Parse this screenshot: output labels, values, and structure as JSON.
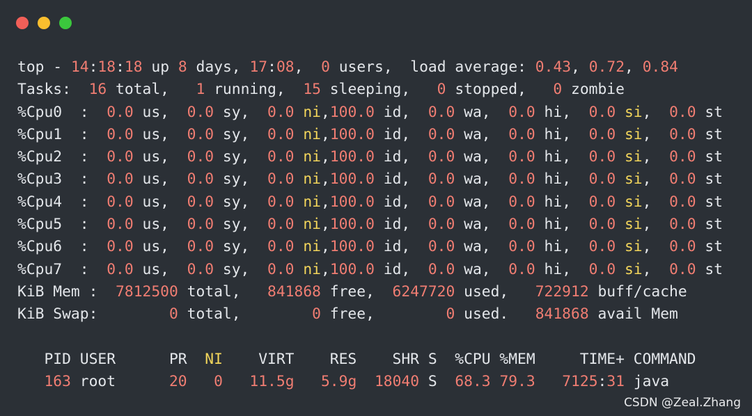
{
  "window": {
    "controls": {
      "close_color": "#f25f58",
      "minimize_color": "#f9be2e",
      "maximize_color": "#3bc73d"
    }
  },
  "colors": {
    "background": "#2b3036",
    "text": "#e3e6ea",
    "value": "#f07d72",
    "highlight": "#f2d55b"
  },
  "terminal": {
    "lines": [
      [
        {
          "t": "top - ",
          "c": "w"
        },
        {
          "t": "14",
          "c": "v"
        },
        {
          "t": ":",
          "c": "w"
        },
        {
          "t": "18",
          "c": "v"
        },
        {
          "t": ":",
          "c": "w"
        },
        {
          "t": "18",
          "c": "v"
        },
        {
          "t": " up ",
          "c": "w"
        },
        {
          "t": "8",
          "c": "v"
        },
        {
          "t": " days, ",
          "c": "w"
        },
        {
          "t": "17",
          "c": "v"
        },
        {
          "t": ":",
          "c": "w"
        },
        {
          "t": "08",
          "c": "v"
        },
        {
          "t": ",  ",
          "c": "w"
        },
        {
          "t": "0",
          "c": "v"
        },
        {
          "t": " users,  load average: ",
          "c": "w"
        },
        {
          "t": "0.43",
          "c": "v"
        },
        {
          "t": ", ",
          "c": "w"
        },
        {
          "t": "0.72",
          "c": "v"
        },
        {
          "t": ", ",
          "c": "w"
        },
        {
          "t": "0.84",
          "c": "v"
        }
      ],
      [
        {
          "t": "Tasks:  ",
          "c": "w"
        },
        {
          "t": "16",
          "c": "v"
        },
        {
          "t": " total,   ",
          "c": "w"
        },
        {
          "t": "1",
          "c": "v"
        },
        {
          "t": " running,  ",
          "c": "w"
        },
        {
          "t": "15",
          "c": "v"
        },
        {
          "t": " sleeping,   ",
          "c": "w"
        },
        {
          "t": "0",
          "c": "v"
        },
        {
          "t": " stopped,   ",
          "c": "w"
        },
        {
          "t": "0",
          "c": "v"
        },
        {
          "t": " zombie",
          "c": "w"
        }
      ],
      [
        {
          "t": "%Cpu0  :  ",
          "c": "w"
        },
        {
          "t": "0.0",
          "c": "v"
        },
        {
          "t": " us,  ",
          "c": "w"
        },
        {
          "t": "0.0",
          "c": "v"
        },
        {
          "t": " sy,  ",
          "c": "w"
        },
        {
          "t": "0.0",
          "c": "v"
        },
        {
          "t": " ",
          "c": "w"
        },
        {
          "t": "ni",
          "c": "y"
        },
        {
          "t": ",",
          "c": "w"
        },
        {
          "t": "100.0",
          "c": "v"
        },
        {
          "t": " id,  ",
          "c": "w"
        },
        {
          "t": "0.0",
          "c": "v"
        },
        {
          "t": " wa,  ",
          "c": "w"
        },
        {
          "t": "0.0",
          "c": "v"
        },
        {
          "t": " hi,  ",
          "c": "w"
        },
        {
          "t": "0.0",
          "c": "v"
        },
        {
          "t": " ",
          "c": "w"
        },
        {
          "t": "si",
          "c": "y"
        },
        {
          "t": ",  ",
          "c": "w"
        },
        {
          "t": "0.0",
          "c": "v"
        },
        {
          "t": " st",
          "c": "w"
        }
      ],
      [
        {
          "t": "%Cpu1  :  ",
          "c": "w"
        },
        {
          "t": "0.0",
          "c": "v"
        },
        {
          "t": " us,  ",
          "c": "w"
        },
        {
          "t": "0.0",
          "c": "v"
        },
        {
          "t": " sy,  ",
          "c": "w"
        },
        {
          "t": "0.0",
          "c": "v"
        },
        {
          "t": " ",
          "c": "w"
        },
        {
          "t": "ni",
          "c": "y"
        },
        {
          "t": ",",
          "c": "w"
        },
        {
          "t": "100.0",
          "c": "v"
        },
        {
          "t": " id,  ",
          "c": "w"
        },
        {
          "t": "0.0",
          "c": "v"
        },
        {
          "t": " wa,  ",
          "c": "w"
        },
        {
          "t": "0.0",
          "c": "v"
        },
        {
          "t": " hi,  ",
          "c": "w"
        },
        {
          "t": "0.0",
          "c": "v"
        },
        {
          "t": " ",
          "c": "w"
        },
        {
          "t": "si",
          "c": "y"
        },
        {
          "t": ",  ",
          "c": "w"
        },
        {
          "t": "0.0",
          "c": "v"
        },
        {
          "t": " st",
          "c": "w"
        }
      ],
      [
        {
          "t": "%Cpu2  :  ",
          "c": "w"
        },
        {
          "t": "0.0",
          "c": "v"
        },
        {
          "t": " us,  ",
          "c": "w"
        },
        {
          "t": "0.0",
          "c": "v"
        },
        {
          "t": " sy,  ",
          "c": "w"
        },
        {
          "t": "0.0",
          "c": "v"
        },
        {
          "t": " ",
          "c": "w"
        },
        {
          "t": "ni",
          "c": "y"
        },
        {
          "t": ",",
          "c": "w"
        },
        {
          "t": "100.0",
          "c": "v"
        },
        {
          "t": " id,  ",
          "c": "w"
        },
        {
          "t": "0.0",
          "c": "v"
        },
        {
          "t": " wa,  ",
          "c": "w"
        },
        {
          "t": "0.0",
          "c": "v"
        },
        {
          "t": " hi,  ",
          "c": "w"
        },
        {
          "t": "0.0",
          "c": "v"
        },
        {
          "t": " ",
          "c": "w"
        },
        {
          "t": "si",
          "c": "y"
        },
        {
          "t": ",  ",
          "c": "w"
        },
        {
          "t": "0.0",
          "c": "v"
        },
        {
          "t": " st",
          "c": "w"
        }
      ],
      [
        {
          "t": "%Cpu3  :  ",
          "c": "w"
        },
        {
          "t": "0.0",
          "c": "v"
        },
        {
          "t": " us,  ",
          "c": "w"
        },
        {
          "t": "0.0",
          "c": "v"
        },
        {
          "t": " sy,  ",
          "c": "w"
        },
        {
          "t": "0.0",
          "c": "v"
        },
        {
          "t": " ",
          "c": "w"
        },
        {
          "t": "ni",
          "c": "y"
        },
        {
          "t": ",",
          "c": "w"
        },
        {
          "t": "100.0",
          "c": "v"
        },
        {
          "t": " id,  ",
          "c": "w"
        },
        {
          "t": "0.0",
          "c": "v"
        },
        {
          "t": " wa,  ",
          "c": "w"
        },
        {
          "t": "0.0",
          "c": "v"
        },
        {
          "t": " hi,  ",
          "c": "w"
        },
        {
          "t": "0.0",
          "c": "v"
        },
        {
          "t": " ",
          "c": "w"
        },
        {
          "t": "si",
          "c": "y"
        },
        {
          "t": ",  ",
          "c": "w"
        },
        {
          "t": "0.0",
          "c": "v"
        },
        {
          "t": " st",
          "c": "w"
        }
      ],
      [
        {
          "t": "%Cpu4  :  ",
          "c": "w"
        },
        {
          "t": "0.0",
          "c": "v"
        },
        {
          "t": " us,  ",
          "c": "w"
        },
        {
          "t": "0.0",
          "c": "v"
        },
        {
          "t": " sy,  ",
          "c": "w"
        },
        {
          "t": "0.0",
          "c": "v"
        },
        {
          "t": " ",
          "c": "w"
        },
        {
          "t": "ni",
          "c": "y"
        },
        {
          "t": ",",
          "c": "w"
        },
        {
          "t": "100.0",
          "c": "v"
        },
        {
          "t": " id,  ",
          "c": "w"
        },
        {
          "t": "0.0",
          "c": "v"
        },
        {
          "t": " wa,  ",
          "c": "w"
        },
        {
          "t": "0.0",
          "c": "v"
        },
        {
          "t": " hi,  ",
          "c": "w"
        },
        {
          "t": "0.0",
          "c": "v"
        },
        {
          "t": " ",
          "c": "w"
        },
        {
          "t": "si",
          "c": "y"
        },
        {
          "t": ",  ",
          "c": "w"
        },
        {
          "t": "0.0",
          "c": "v"
        },
        {
          "t": " st",
          "c": "w"
        }
      ],
      [
        {
          "t": "%Cpu5  :  ",
          "c": "w"
        },
        {
          "t": "0.0",
          "c": "v"
        },
        {
          "t": " us,  ",
          "c": "w"
        },
        {
          "t": "0.0",
          "c": "v"
        },
        {
          "t": " sy,  ",
          "c": "w"
        },
        {
          "t": "0.0",
          "c": "v"
        },
        {
          "t": " ",
          "c": "w"
        },
        {
          "t": "ni",
          "c": "y"
        },
        {
          "t": ",",
          "c": "w"
        },
        {
          "t": "100.0",
          "c": "v"
        },
        {
          "t": " id,  ",
          "c": "w"
        },
        {
          "t": "0.0",
          "c": "v"
        },
        {
          "t": " wa,  ",
          "c": "w"
        },
        {
          "t": "0.0",
          "c": "v"
        },
        {
          "t": " hi,  ",
          "c": "w"
        },
        {
          "t": "0.0",
          "c": "v"
        },
        {
          "t": " ",
          "c": "w"
        },
        {
          "t": "si",
          "c": "y"
        },
        {
          "t": ",  ",
          "c": "w"
        },
        {
          "t": "0.0",
          "c": "v"
        },
        {
          "t": " st",
          "c": "w"
        }
      ],
      [
        {
          "t": "%Cpu6  :  ",
          "c": "w"
        },
        {
          "t": "0.0",
          "c": "v"
        },
        {
          "t": " us,  ",
          "c": "w"
        },
        {
          "t": "0.0",
          "c": "v"
        },
        {
          "t": " sy,  ",
          "c": "w"
        },
        {
          "t": "0.0",
          "c": "v"
        },
        {
          "t": " ",
          "c": "w"
        },
        {
          "t": "ni",
          "c": "y"
        },
        {
          "t": ",",
          "c": "w"
        },
        {
          "t": "100.0",
          "c": "v"
        },
        {
          "t": " id,  ",
          "c": "w"
        },
        {
          "t": "0.0",
          "c": "v"
        },
        {
          "t": " wa,  ",
          "c": "w"
        },
        {
          "t": "0.0",
          "c": "v"
        },
        {
          "t": " hi,  ",
          "c": "w"
        },
        {
          "t": "0.0",
          "c": "v"
        },
        {
          "t": " ",
          "c": "w"
        },
        {
          "t": "si",
          "c": "y"
        },
        {
          "t": ",  ",
          "c": "w"
        },
        {
          "t": "0.0",
          "c": "v"
        },
        {
          "t": " st",
          "c": "w"
        }
      ],
      [
        {
          "t": "%Cpu7  :  ",
          "c": "w"
        },
        {
          "t": "0.0",
          "c": "v"
        },
        {
          "t": " us,  ",
          "c": "w"
        },
        {
          "t": "0.0",
          "c": "v"
        },
        {
          "t": " sy,  ",
          "c": "w"
        },
        {
          "t": "0.0",
          "c": "v"
        },
        {
          "t": " ",
          "c": "w"
        },
        {
          "t": "ni",
          "c": "y"
        },
        {
          "t": ",",
          "c": "w"
        },
        {
          "t": "100.0",
          "c": "v"
        },
        {
          "t": " id,  ",
          "c": "w"
        },
        {
          "t": "0.0",
          "c": "v"
        },
        {
          "t": " wa,  ",
          "c": "w"
        },
        {
          "t": "0.0",
          "c": "v"
        },
        {
          "t": " hi,  ",
          "c": "w"
        },
        {
          "t": "0.0",
          "c": "v"
        },
        {
          "t": " ",
          "c": "w"
        },
        {
          "t": "si",
          "c": "y"
        },
        {
          "t": ",  ",
          "c": "w"
        },
        {
          "t": "0.0",
          "c": "v"
        },
        {
          "t": " st",
          "c": "w"
        }
      ],
      [
        {
          "t": "KiB Mem :  ",
          "c": "w"
        },
        {
          "t": "7812500",
          "c": "v"
        },
        {
          "t": " total,   ",
          "c": "w"
        },
        {
          "t": "841868",
          "c": "v"
        },
        {
          "t": " free,  ",
          "c": "w"
        },
        {
          "t": "6247720",
          "c": "v"
        },
        {
          "t": " used,   ",
          "c": "w"
        },
        {
          "t": "722912",
          "c": "v"
        },
        {
          "t": " buff/cache",
          "c": "w"
        }
      ],
      [
        {
          "t": "KiB Swap:        ",
          "c": "w"
        },
        {
          "t": "0",
          "c": "v"
        },
        {
          "t": " total,        ",
          "c": "w"
        },
        {
          "t": "0",
          "c": "v"
        },
        {
          "t": " free,        ",
          "c": "w"
        },
        {
          "t": "0",
          "c": "v"
        },
        {
          "t": " used.   ",
          "c": "w"
        },
        {
          "t": "841868",
          "c": "v"
        },
        {
          "t": " avail Mem",
          "c": "w"
        }
      ],
      [],
      [
        {
          "t": "   PID USER      PR  ",
          "c": "w"
        },
        {
          "t": "NI",
          "c": "y"
        },
        {
          "t": "    VIRT    RES    SHR S  %CPU %MEM     TIME+ COMMAND",
          "c": "w"
        }
      ],
      [
        {
          "t": "   ",
          "c": "w"
        },
        {
          "t": "163",
          "c": "v"
        },
        {
          "t": " root      ",
          "c": "w"
        },
        {
          "t": "20",
          "c": "v"
        },
        {
          "t": "   ",
          "c": "w"
        },
        {
          "t": "0",
          "c": "v"
        },
        {
          "t": "   ",
          "c": "w"
        },
        {
          "t": "11.5g",
          "c": "v"
        },
        {
          "t": "   ",
          "c": "w"
        },
        {
          "t": "5.9g",
          "c": "v"
        },
        {
          "t": "  ",
          "c": "w"
        },
        {
          "t": "18040",
          "c": "v"
        },
        {
          "t": " S  ",
          "c": "w"
        },
        {
          "t": "68.3",
          "c": "v"
        },
        {
          "t": " ",
          "c": "w"
        },
        {
          "t": "79.3",
          "c": "v"
        },
        {
          "t": "   ",
          "c": "w"
        },
        {
          "t": "7125",
          "c": "v"
        },
        {
          "t": ":",
          "c": "w"
        },
        {
          "t": "31",
          "c": "v"
        },
        {
          "t": " java",
          "c": "w"
        }
      ]
    ]
  },
  "watermark": "CSDN @Zeal.Zhang"
}
